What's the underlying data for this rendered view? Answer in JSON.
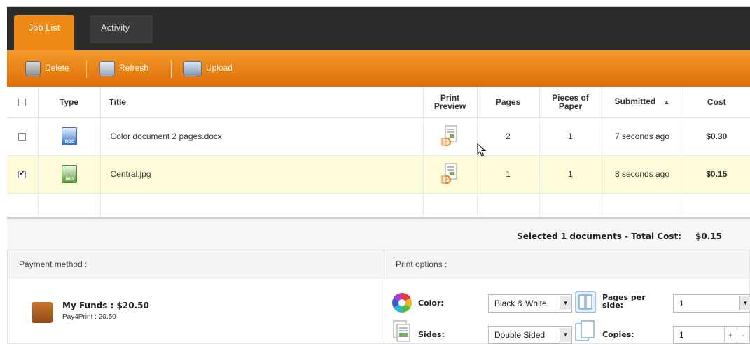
{
  "tabs": [
    {
      "label": "Job List",
      "active": true
    },
    {
      "label": "Activity",
      "active": false
    }
  ],
  "toolbar": {
    "delete_label": "Delete",
    "refresh_label": "Refresh",
    "upload_label": "Upload"
  },
  "table": {
    "headers": {
      "type": "Type",
      "title": "Title",
      "print_preview": "Print Preview",
      "pages": "Pages",
      "pieces": "Pieces of Paper",
      "submitted": "Submitted",
      "cost": "Cost"
    },
    "rows": [
      {
        "checked": false,
        "type_label": "DOC",
        "title": "Color document 2 pages.docx",
        "pages": "2",
        "pieces": "1",
        "submitted": "7 seconds ago",
        "cost": "$0.30"
      },
      {
        "checked": true,
        "type_label": "IMG",
        "title": "Central.jpg",
        "pages": "1",
        "pieces": "1",
        "submitted": "8 seconds ago",
        "cost": "$0.15"
      }
    ]
  },
  "summary": {
    "text": "Selected 1 documents - Total Cost:",
    "value": "$0.15"
  },
  "payment": {
    "header": "Payment method :",
    "funds_title": "My Funds : $20.50",
    "funds_sub": "Pay4Print : 20.50"
  },
  "print_options": {
    "header": "Print options :",
    "color_label": "Color:",
    "color_value": "Black & White",
    "pages_per_side_label": "Pages per side:",
    "pages_per_side_value": "1",
    "sides_label": "Sides:",
    "sides_value": "Double Sided",
    "copies_label": "Copies:",
    "copies_value": "1"
  },
  "colors": {
    "accent": "#f08a17",
    "dark_bar": "#2b2b2b",
    "selected_row": "#fefbd8"
  }
}
